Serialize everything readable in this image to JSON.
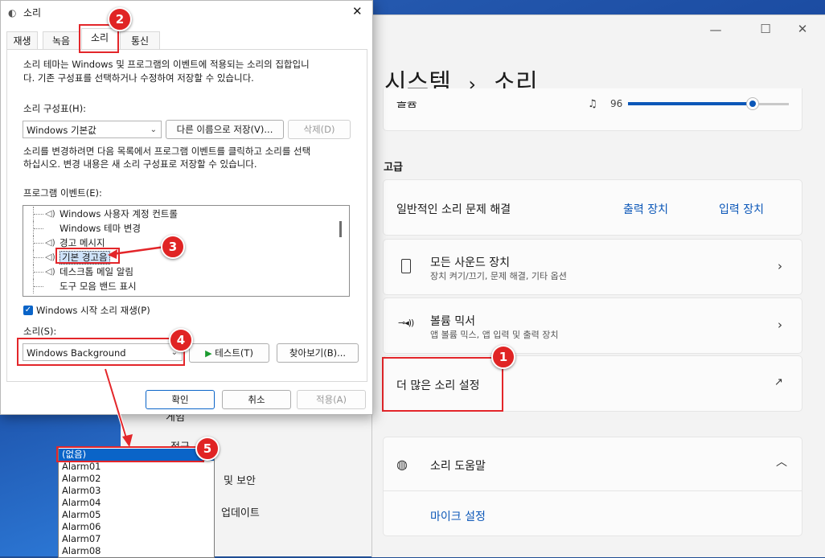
{
  "dialog": {
    "title": "소리",
    "close_glyph": "✕",
    "tabs": [
      "재생",
      "녹음",
      "소리",
      "통신"
    ],
    "active_tab": "소리",
    "description": [
      "소리 테마는 Windows 및 프로그램의 이벤트에 적용되는 소리의 집합입니",
      "다. 기존 구성표를 선택하거나 수정하여 저장할 수 있습니다."
    ],
    "scheme_label": "소리 구성표(H):",
    "scheme_value": "Windows 기본값",
    "save_as_label": "다른 이름으로 저장(V)...",
    "delete_label": "삭제(D)",
    "change_hint": [
      "소리를 변경하려면 다음 목록에서 프로그램 이벤트를 클릭하고 소리를 선택",
      "하십시오. 변경 내용은 새 소리 구성표로 저장할 수 있습니다."
    ],
    "events_label": "프로그램 이벤트(E):",
    "events": [
      {
        "label": "Windows 사용자 계정 컨트롤",
        "has_sound": true,
        "selected": false
      },
      {
        "label": "Windows 테마 변경",
        "has_sound": false,
        "selected": false
      },
      {
        "label": "경고 메시지",
        "has_sound": true,
        "selected": false
      },
      {
        "label": "기본 경고음",
        "has_sound": true,
        "selected": true
      },
      {
        "label": "데스크톱 메일 알림",
        "has_sound": true,
        "selected": false
      },
      {
        "label": "도구 모음 밴드 표시",
        "has_sound": false,
        "selected": false
      }
    ],
    "startup_checkbox_label": "Windows 시작 소리 재생(P)",
    "startup_checked": true,
    "sound_label": "소리(S):",
    "sound_value": "Windows Background",
    "test_label": "테스트(T)",
    "browse_label": "찾아보기(B)...",
    "ok_label": "확인",
    "cancel_label": "취소",
    "apply_label": "적용(A)"
  },
  "sound_dropdown": {
    "options": [
      "(없음)",
      "Alarm01",
      "Alarm02",
      "Alarm03",
      "Alarm04",
      "Alarm05",
      "Alarm06",
      "Alarm07",
      "Alarm08"
    ],
    "highlighted": "(없음)"
  },
  "settings": {
    "breadcrumb_parent": "시스템",
    "breadcrumb_sep": "›",
    "breadcrumb_current": "소리",
    "volume_label": "볼륨",
    "volume_value": "96",
    "volume_level": 0.96,
    "advanced_header": "고급",
    "troubleshoot_label": "일반적인 소리 문제 해결",
    "output_device_link": "출력 장치",
    "input_device_link": "입력 장치",
    "all_devices_title": "모든 사운드 장치",
    "all_devices_sub": "장치 켜기/끄기, 문제 해결, 기타 옵션",
    "mixer_title": "볼륨 믹서",
    "mixer_sub": "앱 볼륨 믹스, 앱 입력 및 출력 장치",
    "more_settings_label": "더 많은 소리 설정",
    "help_title": "소리 도움말",
    "mic_settings_link": "마이크 설정"
  },
  "background_window": {
    "items": [
      "게임",
      "접근",
      "및 보안",
      "업데이트"
    ]
  },
  "annotations": [
    "1",
    "2",
    "3",
    "4",
    "5"
  ],
  "colors": {
    "accent": "#0b57b8",
    "annotation_red": "#e3262a",
    "selection_blue": "#0a64c8"
  }
}
